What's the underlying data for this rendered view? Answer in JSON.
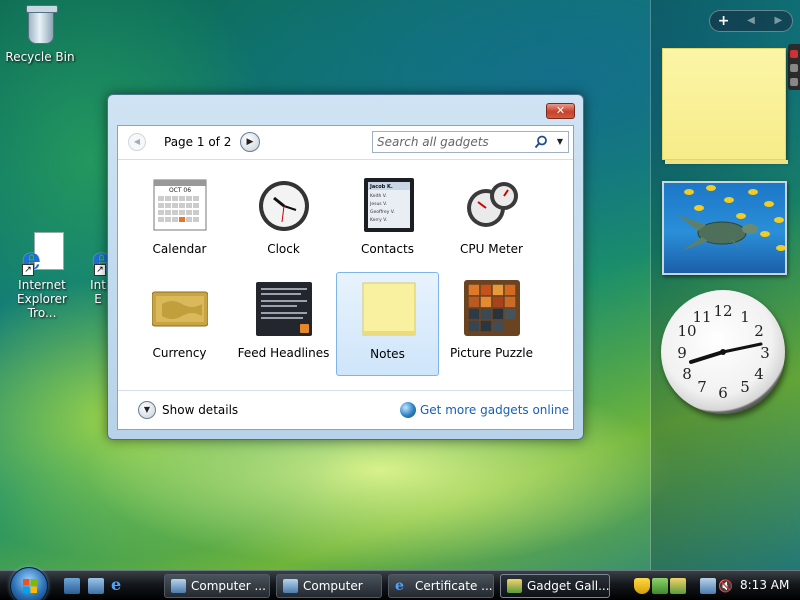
{
  "desktop": {
    "icons": [
      {
        "label": "Recycle Bin"
      },
      {
        "label": "Internet Explorer Tro..."
      },
      {
        "label": "Int E"
      }
    ]
  },
  "sidebar": {
    "toolbar": {
      "add": "+",
      "prev": "◀",
      "next": "▶"
    }
  },
  "dialog": {
    "close": "✕",
    "page_label": "Page 1 of 2",
    "search_placeholder": "Search all gadgets",
    "gadgets": [
      {
        "name": "Calendar",
        "icon": "calendar-icon",
        "calendar_month": "OCT 06"
      },
      {
        "name": "Clock",
        "icon": "clock-icon"
      },
      {
        "name": "Contacts",
        "icon": "contacts-icon",
        "contacts": [
          "Jacob K.",
          "Keith V.",
          "Jesus V.",
          "Geoffrey V.",
          "Kerry V."
        ]
      },
      {
        "name": "CPU Meter",
        "icon": "cpu-meter-icon"
      },
      {
        "name": "Currency",
        "icon": "currency-icon"
      },
      {
        "name": "Feed Headlines",
        "icon": "feed-headlines-icon"
      },
      {
        "name": "Notes",
        "icon": "notes-icon",
        "selected": true
      },
      {
        "name": "Picture Puzzle",
        "icon": "picture-puzzle-icon"
      }
    ],
    "show_details": "Show details",
    "get_more": "Get more gadgets online"
  },
  "taskbar": {
    "buttons": [
      {
        "label": "Computer ...",
        "active": false
      },
      {
        "label": "Computer",
        "active": false
      },
      {
        "label": "Certificate ...",
        "active": false
      },
      {
        "label": "Gadget Gall...",
        "active": true
      }
    ],
    "clock": "8:13 AM"
  },
  "colors": {
    "link": "#1560b8",
    "close_red": "#c6412b",
    "selection": "#cfe5fa"
  }
}
